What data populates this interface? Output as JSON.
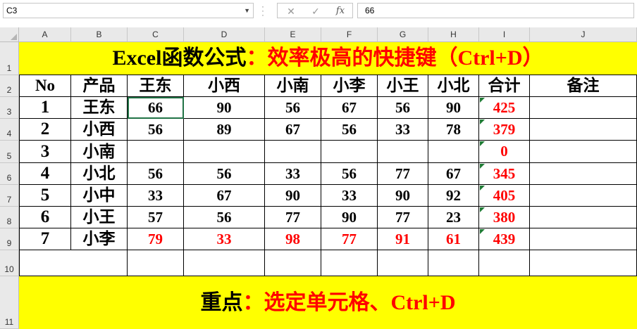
{
  "formula_bar": {
    "name_box": "C3",
    "formula": "66",
    "buttons": [
      {
        "name": "cancel",
        "label": "✕"
      },
      {
        "name": "enter",
        "label": "✓"
      },
      {
        "name": "insert-function",
        "label": "fx"
      }
    ]
  },
  "columns": [
    "A",
    "B",
    "C",
    "D",
    "E",
    "F",
    "G",
    "H",
    "I",
    "J"
  ],
  "rows": [
    "1",
    "2",
    "3",
    "4",
    "5",
    "6",
    "7",
    "8",
    "9",
    "10",
    "11"
  ],
  "title": {
    "prefix": "Excel函数公式",
    "suffix": "：效率极高的快捷键（Ctrl+D）"
  },
  "table": {
    "headers": [
      "No",
      "产品",
      "王东",
      "小西",
      "小南",
      "小李",
      "小王",
      "小北",
      "合计",
      "备注"
    ],
    "rows": [
      {
        "no": "1",
        "product": "王东",
        "values": [
          "66",
          "90",
          "56",
          "67",
          "56",
          "90"
        ],
        "total": "425",
        "note": "",
        "highlight": false
      },
      {
        "no": "2",
        "product": "小西",
        "values": [
          "56",
          "89",
          "67",
          "56",
          "33",
          "78"
        ],
        "total": "379",
        "note": "",
        "highlight": false
      },
      {
        "no": "3",
        "product": "小南",
        "values": [
          "",
          "",
          "",
          "",
          "",
          ""
        ],
        "total": "0",
        "note": "",
        "highlight": false
      },
      {
        "no": "4",
        "product": "小北",
        "values": [
          "56",
          "56",
          "33",
          "56",
          "77",
          "67"
        ],
        "total": "345",
        "note": "",
        "highlight": false
      },
      {
        "no": "5",
        "product": "小中",
        "values": [
          "33",
          "67",
          "90",
          "33",
          "90",
          "92"
        ],
        "total": "405",
        "note": "",
        "highlight": false
      },
      {
        "no": "6",
        "product": "小王",
        "values": [
          "57",
          "56",
          "77",
          "90",
          "77",
          "23"
        ],
        "total": "380",
        "note": "",
        "highlight": false
      },
      {
        "no": "7",
        "product": "小李",
        "values": [
          "79",
          "33",
          "98",
          "77",
          "91",
          "61"
        ],
        "total": "439",
        "note": "",
        "highlight": true
      }
    ]
  },
  "footer": {
    "prefix": "重点",
    "suffix": "：选定单元格、Ctrl+D"
  },
  "colors": {
    "highlight": "#ffff00",
    "accent_red": "#ff0000",
    "error_indicator": "#1e7b34"
  }
}
